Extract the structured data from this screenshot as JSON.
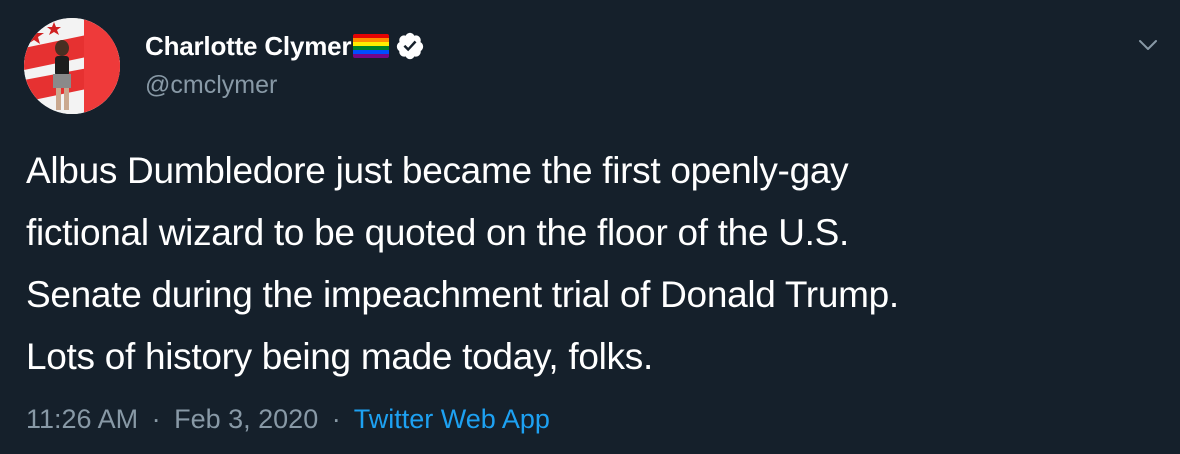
{
  "tweet": {
    "author": {
      "display_name": "Charlotte Clymer",
      "name_emoji": "rainbow-flag",
      "verified": true,
      "handle": "@cmclymer",
      "avatar_icon": "profile-photo"
    },
    "text": "Albus Dumbledore just became the first openly-gay\nfictional wizard to be quoted on the floor of the U.S.\nSenate during the impeachment trial of Donald Trump.\nLots of history being made today, folks.",
    "time": "11:26 AM",
    "separator": "·",
    "date": "Feb 3, 2020",
    "source": "Twitter Web App",
    "menu_icon": "chevron-down-icon"
  },
  "colors": {
    "background": "#15202b",
    "text": "#ffffff",
    "secondary_text": "#8899a6",
    "link": "#1da1f2"
  }
}
